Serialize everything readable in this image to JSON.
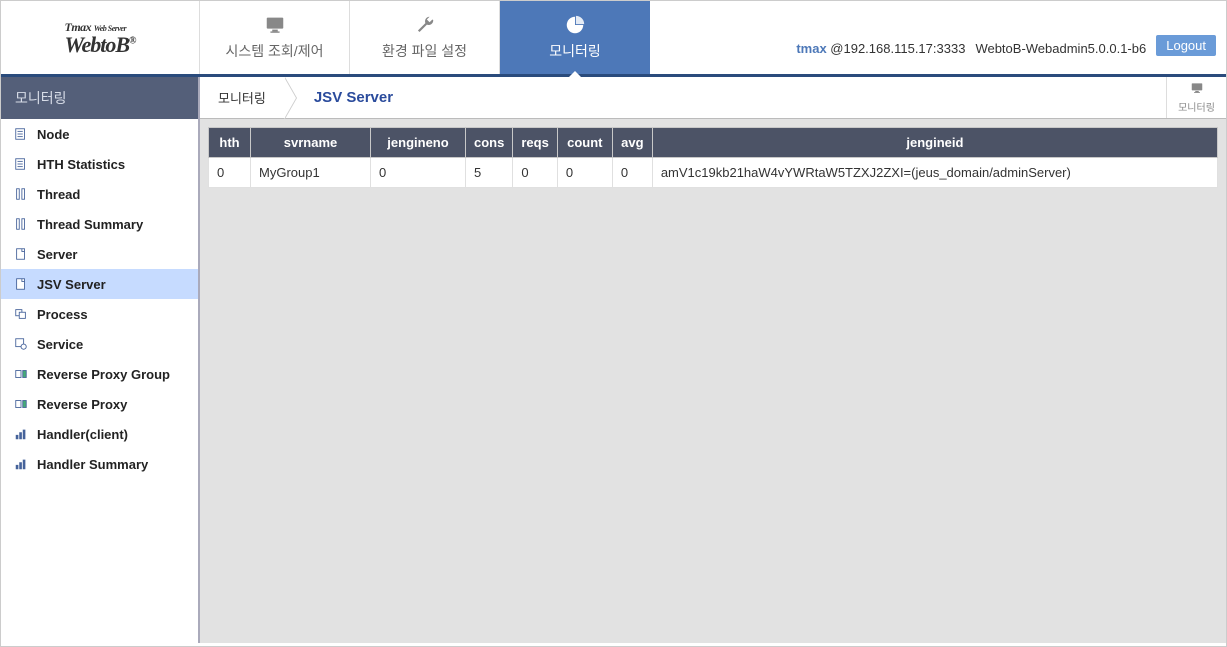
{
  "logo": {
    "line1_prefix": "Tmax",
    "line1_suffix": "Web Server",
    "line2": "WebtoB",
    "reg": "®"
  },
  "top_tabs": [
    {
      "icon": "monitor-icon",
      "label": "시스템 조회/제어",
      "active": false
    },
    {
      "icon": "wrench-icon",
      "label": "환경 파일 설정",
      "active": false
    },
    {
      "icon": "piechart-icon",
      "label": "모니터링",
      "active": true
    }
  ],
  "header": {
    "username": "tmax",
    "at_addr": " @192.168.115.17:3333",
    "version": "WebtoB-Webadmin5.0.0.1-b6",
    "logout": "Logout"
  },
  "sidebar": {
    "title": "모니터링",
    "items": [
      {
        "label": "Node",
        "icon": "doc"
      },
      {
        "label": "HTH Statistics",
        "icon": "doc"
      },
      {
        "label": "Thread",
        "icon": "threads"
      },
      {
        "label": "Thread Summary",
        "icon": "threads"
      },
      {
        "label": "Server",
        "icon": "page"
      },
      {
        "label": "JSV Server",
        "icon": "page",
        "active": true
      },
      {
        "label": "Process",
        "icon": "stack"
      },
      {
        "label": "Service",
        "icon": "gear"
      },
      {
        "label": "Reverse Proxy Group",
        "icon": "proxy"
      },
      {
        "label": "Reverse Proxy",
        "icon": "proxy"
      },
      {
        "label": "Handler(client)",
        "icon": "chart"
      },
      {
        "label": "Handler Summary",
        "icon": "chart"
      }
    ]
  },
  "breadcrumb": {
    "root": "모니터링",
    "current": "JSV Server",
    "monitor_btn": "모니터링"
  },
  "table": {
    "columns": [
      "hth",
      "svrname",
      "jengineno",
      "cons",
      "reqs",
      "count",
      "avg",
      "jengineid"
    ],
    "rows": [
      {
        "hth": "0",
        "svrname": "MyGroup1",
        "jengineno": "0",
        "cons": "5",
        "reqs": "0",
        "count": "0",
        "avg": "0",
        "jengineid": "amV1c19kb21haW4vYWRtaW5TZXJ2ZXI=(jeus_domain/adminServer)"
      }
    ]
  }
}
